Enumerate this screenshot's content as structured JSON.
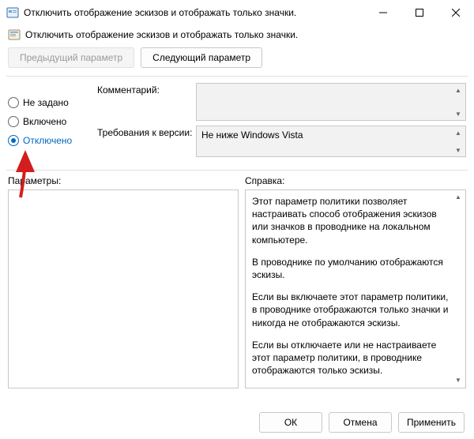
{
  "window": {
    "title": "Отключить отображение эскизов и отображать только значки."
  },
  "heading": "Отключить отображение эскизов и отображать только значки.",
  "toolbar": {
    "prev": "Предыдущий параметр",
    "next": "Следующий параметр"
  },
  "radios": {
    "not_configured": "Не задано",
    "enabled": "Включено",
    "disabled": "Отключено",
    "selected": "disabled"
  },
  "fields": {
    "comment_label": "Комментарий:",
    "comment_value": "",
    "version_label": "Требования к версии:",
    "version_value": "Не ниже Windows Vista"
  },
  "lower": {
    "options_label": "Параметры:",
    "help_label": "Справка:"
  },
  "help": {
    "p1": "Этот параметр политики позволяет настраивать способ отображения эскизов или значков в проводнике на локальном компьютере.",
    "p2": "В проводнике по умолчанию отображаются эскизы.",
    "p3": "Если вы включаете этот параметр политики, в проводнике отображаются только значки и никогда не отображаются эскизы.",
    "p4": "Если вы отключаете или не настраиваете этот параметр политики, в проводнике отображаются только эскизы."
  },
  "footer": {
    "ok": "ОК",
    "cancel": "Отмена",
    "apply": "Применить"
  },
  "glyphs": {
    "up": "▲",
    "down": "▼"
  }
}
